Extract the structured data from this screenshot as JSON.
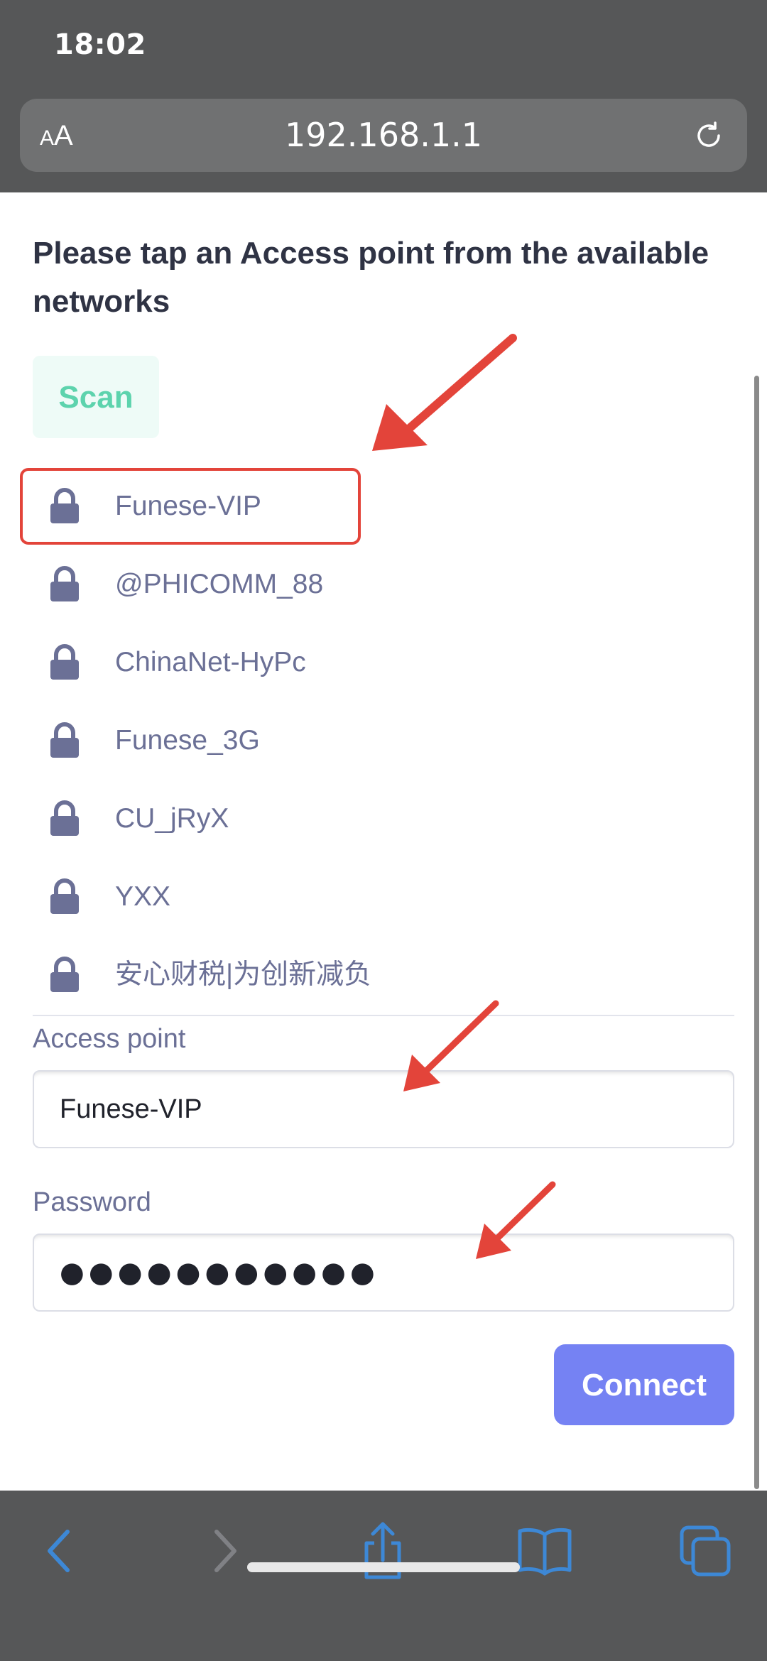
{
  "status_bar": {
    "time": "18:02"
  },
  "browser": {
    "text_size_label_small": "A",
    "text_size_label_large": "A",
    "url": "192.168.1.1"
  },
  "page": {
    "heading": "Please tap an Access point from the available networks",
    "scan_label": "Scan",
    "networks": [
      {
        "ssid": "Funese-VIP",
        "secured": true,
        "highlighted": true
      },
      {
        "ssid": "@PHICOMM_88",
        "secured": true,
        "highlighted": false
      },
      {
        "ssid": "ChinaNet-HyPc",
        "secured": true,
        "highlighted": false
      },
      {
        "ssid": "Funese_3G",
        "secured": true,
        "highlighted": false
      },
      {
        "ssid": "CU_jRyX",
        "secured": true,
        "highlighted": false
      },
      {
        "ssid": "YXX",
        "secured": true,
        "highlighted": false
      },
      {
        "ssid": "安心财税|为创新减负",
        "secured": true,
        "highlighted": false
      }
    ],
    "access_point_label": "Access point",
    "access_point_value": "Funese-VIP",
    "password_label": "Password",
    "password_value": "●●●●●●●●●●●",
    "connect_label": "Connect"
  },
  "toolbar": {
    "items": [
      "back-icon",
      "forward-icon",
      "share-icon",
      "bookmarks-icon",
      "tabs-icon"
    ]
  },
  "colors": {
    "chrome": "#565758",
    "accent": "#7582f3",
    "scan_text": "#5dd3ad",
    "annotation_red": "#e3443a",
    "list_text": "#6b7096",
    "toolbar_icon": "#3d88d6"
  }
}
